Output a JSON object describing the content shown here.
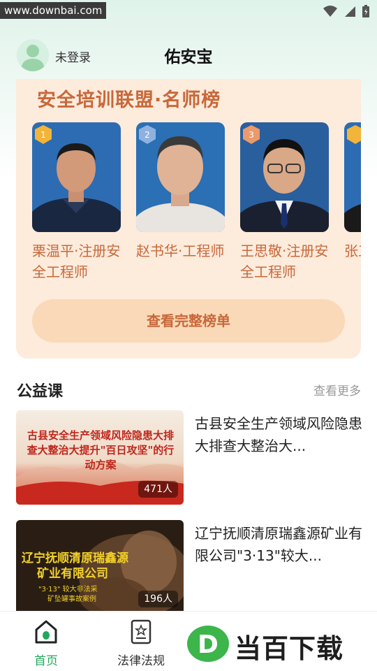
{
  "status_bar": {
    "watermark_url": "www.downbai.com",
    "icons": [
      "wifi-icon",
      "signal-icon",
      "battery-icon"
    ]
  },
  "header": {
    "login_status": "未登录",
    "title": "佑安宝"
  },
  "ranking": {
    "title": "安全培训联盟·名师榜",
    "teachers": [
      {
        "rank": "1",
        "name": "栗温平·注册安全工程师",
        "badge_color": "#f3b43a"
      },
      {
        "rank": "2",
        "name": "赵书华·工程师",
        "badge_color": "#8fb1e0"
      },
      {
        "rank": "3",
        "name": "王思敬·注册安全工程师",
        "badge_color": "#ec9a6c"
      },
      {
        "rank": "",
        "name": "张工",
        "badge_color": "#f3b43a"
      }
    ],
    "view_all_label": "查看完整榜单"
  },
  "courses_section": {
    "title": "公益课",
    "more_label": "查看更多",
    "courses": [
      {
        "title": "古县安全生产领域风险隐患大排查大整治大...",
        "thumb_text": "古县安全生产领域风险隐患大排查大整治大提升\"百日攻坚\"的行动方案",
        "count": "471人"
      },
      {
        "title": "辽宁抚顺清原瑞鑫源矿业有限公司\"3·13\"较大...",
        "thumb_text_1": "辽宁抚顺清原瑞鑫源",
        "thumb_text_2": "矿业有限公司",
        "thumb_text_3": "\"3·13\" 较大非法采",
        "thumb_text_4": "矿坠罐事故案例",
        "count": "196人"
      }
    ]
  },
  "bottom_nav": {
    "items": [
      {
        "label": "首页",
        "icon": "home-icon",
        "active": true
      },
      {
        "label": "法律法规",
        "icon": "law-document-icon",
        "active": false
      }
    ]
  },
  "watermark_logo": {
    "letter": "D",
    "text": "当百下载"
  },
  "colors": {
    "accent_green": "#22a85b",
    "rank_orange": "#c8683a",
    "card_bg": "#fdebdc"
  }
}
